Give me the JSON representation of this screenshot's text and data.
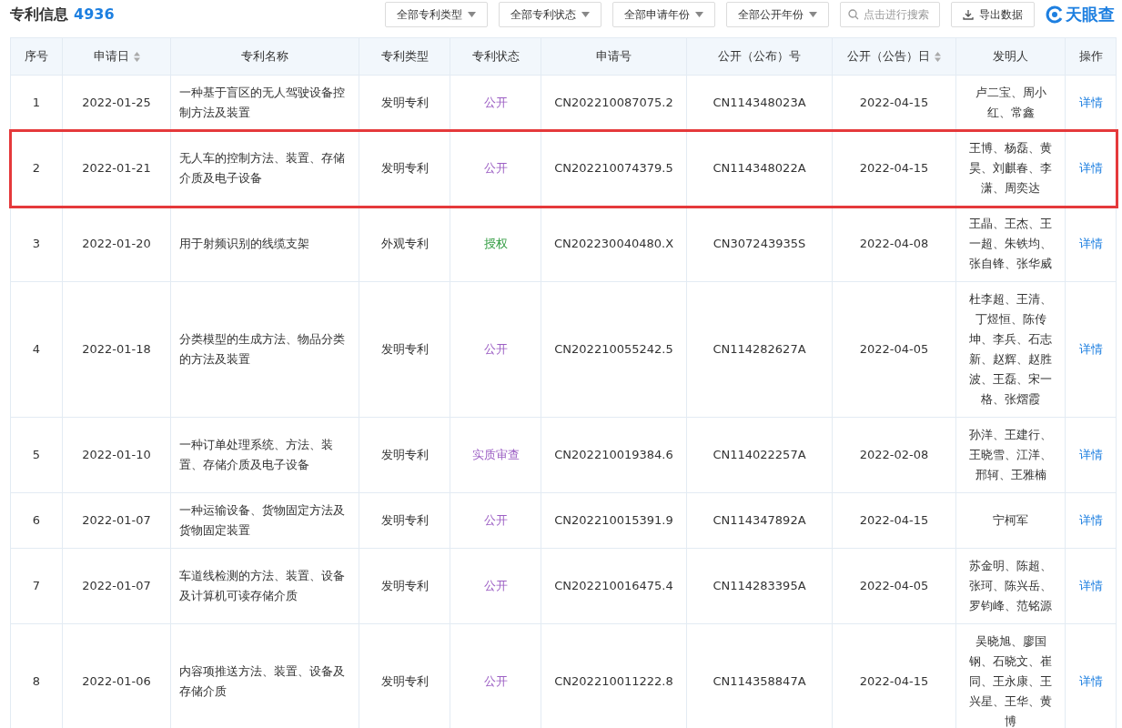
{
  "header": {
    "title": "专利信息",
    "count": "4936"
  },
  "filters": [
    "全部专利类型",
    "全部专利状态",
    "全部申请年份",
    "全部公开年份"
  ],
  "search": {
    "placeholder": "点击进行搜索"
  },
  "export_button": "导出数据",
  "logo": "天眼查",
  "table": {
    "columns": [
      {
        "label": "序号",
        "sortable": false
      },
      {
        "label": "申请日",
        "sortable": true
      },
      {
        "label": "专利名称",
        "sortable": false
      },
      {
        "label": "专利类型",
        "sortable": false
      },
      {
        "label": "专利状态",
        "sortable": false
      },
      {
        "label": "申请号",
        "sortable": false
      },
      {
        "label": "公开（公布）号",
        "sortable": false
      },
      {
        "label": "公开（公告）日",
        "sortable": true
      },
      {
        "label": "发明人",
        "sortable": false
      },
      {
        "label": "操作",
        "sortable": false
      }
    ],
    "rows": [
      {
        "no": "1",
        "date": "2022-01-25",
        "name": "一种基于盲区的无人驾驶设备控制方法及装置",
        "type": "发明专利",
        "status": {
          "text": "公开",
          "kind": "public"
        },
        "app_no": "CN202210087075.2",
        "pub_no": "CN114348023A",
        "pub_date": "2022-04-15",
        "inventors": "卢二宝、周小红、常鑫",
        "action": "详情",
        "highlighted": false
      },
      {
        "no": "2",
        "date": "2022-01-21",
        "name": "无人车的控制方法、装置、存储介质及电子设备",
        "type": "发明专利",
        "status": {
          "text": "公开",
          "kind": "public"
        },
        "app_no": "CN202210074379.5",
        "pub_no": "CN114348022A",
        "pub_date": "2022-04-15",
        "inventors": "王博、杨磊、黄昊、刘麒春、李潇、周奕达",
        "action": "详情",
        "highlighted": true
      },
      {
        "no": "3",
        "date": "2022-01-20",
        "name": "用于射频识别的线缆支架",
        "type": "外观专利",
        "status": {
          "text": "授权",
          "kind": "granted"
        },
        "app_no": "CN202230040480.X",
        "pub_no": "CN307243935S",
        "pub_date": "2022-04-08",
        "inventors": "王晶、王杰、王一超、朱铁均、张自锋、张华威",
        "action": "详情",
        "highlighted": false
      },
      {
        "no": "4",
        "date": "2022-01-18",
        "name": "分类模型的生成方法、物品分类的方法及装置",
        "type": "发明专利",
        "status": {
          "text": "公开",
          "kind": "public"
        },
        "app_no": "CN202210055242.5",
        "pub_no": "CN114282627A",
        "pub_date": "2022-04-05",
        "inventors": "杜李超、王清、丁煜恒、陈传坤、李兵、石志新、赵辉、赵胜波、王磊、宋一格、张熠霞",
        "action": "详情",
        "highlighted": false
      },
      {
        "no": "5",
        "date": "2022-01-10",
        "name": "一种订单处理系统、方法、装置、存储介质及电子设备",
        "type": "发明专利",
        "status": {
          "text": "实质审查",
          "kind": "examination"
        },
        "app_no": "CN202210019384.6",
        "pub_no": "CN114022257A",
        "pub_date": "2022-02-08",
        "inventors": "孙洋、王建行、王晓雪、江洋、邢轲、王雅楠",
        "action": "详情",
        "highlighted": false
      },
      {
        "no": "6",
        "date": "2022-01-07",
        "name": "一种运输设备、货物固定方法及货物固定装置",
        "type": "发明专利",
        "status": {
          "text": "公开",
          "kind": "public"
        },
        "app_no": "CN202210015391.9",
        "pub_no": "CN114347892A",
        "pub_date": "2022-04-15",
        "inventors": "宁柯军",
        "action": "详情",
        "highlighted": false
      },
      {
        "no": "7",
        "date": "2022-01-07",
        "name": "车道线检测的方法、装置、设备及计算机可读存储介质",
        "type": "发明专利",
        "status": {
          "text": "公开",
          "kind": "public"
        },
        "app_no": "CN202210016475.4",
        "pub_no": "CN114283395A",
        "pub_date": "2022-04-05",
        "inventors": "苏金明、陈超、张珂、陈兴岳、罗钧峰、范铭源",
        "action": "详情",
        "highlighted": false
      },
      {
        "no": "8",
        "date": "2022-01-06",
        "name": "内容项推送方法、装置、设备及存储介质",
        "type": "发明专利",
        "status": {
          "text": "公开",
          "kind": "public"
        },
        "app_no": "CN202210011222.8",
        "pub_no": "CN114358847A",
        "pub_date": "2022-04-15",
        "inventors": "吴晓旭、廖国钢、石晓文、崔同、王永康、王兴星、王华、黄博",
        "action": "详情",
        "highlighted": false
      }
    ]
  }
}
